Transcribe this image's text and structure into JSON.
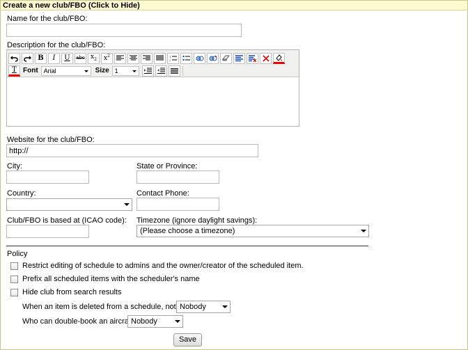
{
  "header": {
    "title": "Create a new club/FBO (Click to Hide)"
  },
  "name": {
    "label": "Name for the club/FBO:",
    "value": ""
  },
  "description": {
    "label": "Description for the club/FBO:",
    "font_label": "Font",
    "font_value": "Arial",
    "size_label": "Size",
    "size_value": "1"
  },
  "website": {
    "label": "Website for the club/FBO:",
    "value": "http://"
  },
  "city": {
    "label": "City:",
    "value": ""
  },
  "state": {
    "label": "State or Province:",
    "value": ""
  },
  "country": {
    "label": "Country:",
    "value": ""
  },
  "phone": {
    "label": "Contact Phone:",
    "value": ""
  },
  "icao": {
    "label": "Club/FBO is based at (ICAO code):",
    "value": ""
  },
  "timezone": {
    "label": "Timezone (ignore daylight savings):",
    "value": "(Please choose a timezone)"
  },
  "policy": {
    "title": "Policy",
    "options": [
      {
        "label": "Restrict editing of schedule to admins and the owner/creator of the scheduled item.",
        "checked": false
      },
      {
        "label": "Prefix all scheduled items with the scheduler's name",
        "checked": false
      },
      {
        "label": "Hide club from search results",
        "checked": false
      }
    ],
    "notify_label": "When an item is deleted from a schedule, notify:",
    "notify_value": "Nobody",
    "double_book_label": "Who can double-book an aircraft:",
    "double_book_value": "Nobody"
  },
  "save_label": "Save",
  "toolbar_icons": [
    "undo-icon",
    "redo-icon",
    "bold-icon",
    "italic-icon",
    "underline-icon",
    "strikethrough-icon",
    "subscript-icon",
    "superscript-icon",
    "align-left-icon",
    "align-center-icon",
    "align-right-icon",
    "justify-icon",
    "numbered-list-icon",
    "bulleted-list-icon",
    "link-icon",
    "unlink-icon",
    "eraser-icon",
    "paragraph-icon",
    "remove-format-icon",
    "delete-icon",
    "highlight-color-icon",
    "text-color-icon",
    "indent-icon",
    "outdent-icon",
    "horizontal-rule-icon"
  ]
}
